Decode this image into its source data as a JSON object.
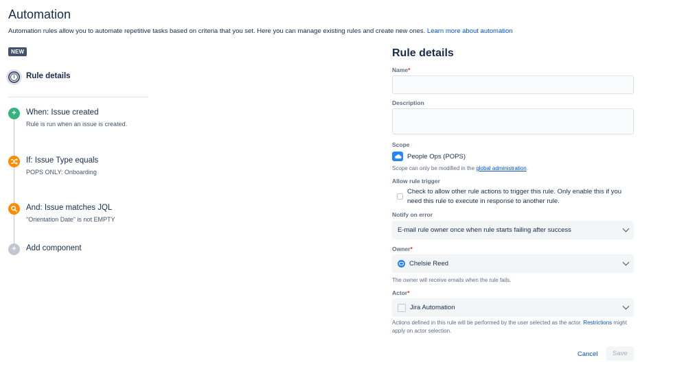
{
  "page": {
    "title": "Automation",
    "description": "Automation rules allow you to automate repetitive tasks based on criteria that you set. Here you can manage existing rules and create new ones. ",
    "learn_more_link": "Learn more about automation",
    "badge": "NEW"
  },
  "components": [
    {
      "title": "Rule details",
      "subtitle": "",
      "icon": "info-icon",
      "color": "#42526e"
    },
    {
      "title": "When: Issue created",
      "subtitle": "Rule is run when an issue is created.",
      "icon": "plus-icon",
      "color": "#36b37e"
    },
    {
      "title": "If: Issue Type equals",
      "subtitle": "POPS ONLY: Onboarding",
      "icon": "shuffle-icon",
      "color": "#ff8b00"
    },
    {
      "title": "And: Issue matches JQL",
      "subtitle": "\"Orientation Date\" is not EMPTY",
      "icon": "search-icon",
      "color": "#ff8b00"
    },
    {
      "title": "Add component",
      "subtitle": "",
      "icon": "plus-icon",
      "color": "#c1c7d0"
    }
  ],
  "form": {
    "title": "Rule details",
    "name_label": "Name",
    "name_value": "",
    "description_label": "Description",
    "description_value": "",
    "scope_label": "Scope",
    "scope_value": "People Ops (POPS)",
    "scope_help": "Scope can only be modified in the ",
    "scope_help_link": "global administration",
    "scope_help_end": ".",
    "allow_trigger_label": "Allow rule trigger",
    "allow_trigger_text": "Check to allow other rule actions to trigger this rule. Only enable this if you need this rule to execute in response to another rule.",
    "notify_label": "Notify on error",
    "notify_value": "E-mail rule owner once when rule starts failing after success",
    "owner_label": "Owner",
    "owner_value": "Chelsie Reed",
    "owner_help": "The owner will receive emails when the rule fails.",
    "actor_label": "Actor",
    "actor_value": "Jira Automation",
    "actor_help": "Actions defined in this rule will be performed by the user selected as the actor. ",
    "actor_help_link": "Restrictions",
    "actor_help_end": " might apply on actor selection.",
    "required_mark": "*",
    "cancel_label": "Cancel",
    "save_label": "Save"
  }
}
